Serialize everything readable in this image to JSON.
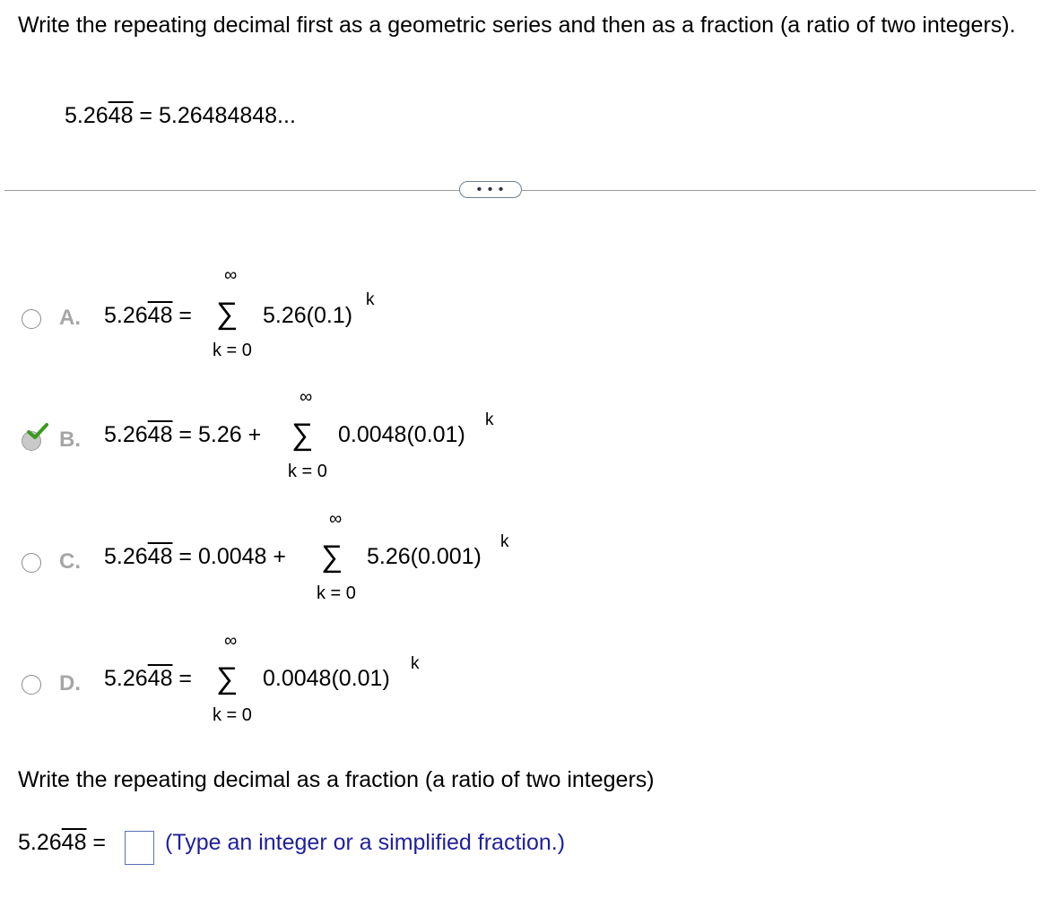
{
  "question": {
    "text": "Write the repeating decimal first as a geometric series and then as a fraction (a ratio of two integers).",
    "given_int": "5.26",
    "given_rep": "48",
    "given_rest": " = 5.26484848..."
  },
  "more_button": "• • •",
  "options": [
    {
      "letter": "A.",
      "selected": false,
      "lhs_int": "5.26",
      "lhs_rep": "48",
      "eq": " =",
      "prefix": "",
      "sigma": "∑",
      "top": "∞",
      "bottom": "k = 0",
      "term": "5.26(0.1)",
      "exp": "k"
    },
    {
      "letter": "B.",
      "selected": true,
      "lhs_int": "5.26",
      "lhs_rep": "48",
      "eq": " = 5.26 +",
      "prefix": "",
      "sigma": "∑",
      "top": "∞",
      "bottom": "k = 0",
      "term": "0.0048(0.01)",
      "exp": "k"
    },
    {
      "letter": "C.",
      "selected": false,
      "lhs_int": "5.26",
      "lhs_rep": "48",
      "eq": " = 0.0048 +",
      "prefix": "",
      "sigma": "∑",
      "top": "∞",
      "bottom": "k = 0",
      "term": "5.26(0.001)",
      "exp": "k"
    },
    {
      "letter": "D.",
      "selected": false,
      "lhs_int": "5.26",
      "lhs_rep": "48",
      "eq": " =",
      "prefix": "",
      "sigma": "∑",
      "top": "∞",
      "bottom": "k = 0",
      "term": "0.0048(0.01)",
      "exp": "k"
    }
  ],
  "fraction_prompt": "Write the repeating decimal as a fraction (a ratio of two integers)",
  "answer": {
    "lhs_int": "5.26",
    "lhs_rep": "48",
    "eq": " =",
    "value": "",
    "hint": "(Type an integer or a simplified fraction.)"
  },
  "colors": {
    "check": "#3a9a1e",
    "hint": "#1f1f9c",
    "letter": "#a6a6a6"
  }
}
